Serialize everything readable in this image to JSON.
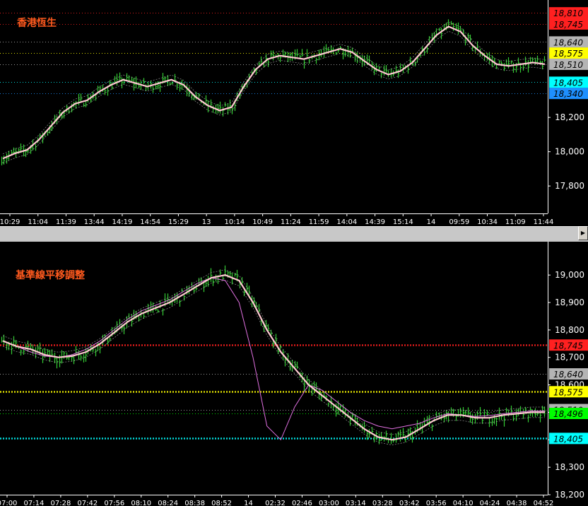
{
  "chart_data": [
    {
      "type": "line",
      "title": "香港恆生",
      "xlabel": "",
      "ylabel": "",
      "ylim": [
        17640,
        18860
      ],
      "y_ticks": [
        "18,200",
        "18,000",
        "17,800"
      ],
      "x_tick_labels": [
        "10:29",
        "11:04",
        "11:39",
        "13:44",
        "14:19",
        "14:54",
        "15:29",
        "13",
        "10:14",
        "10:49",
        "11:24",
        "11:59",
        "14:04",
        "14:39",
        "15:14",
        "14",
        "09:59",
        "10:34",
        "11:09",
        "11:44"
      ],
      "level_badges": [
        {
          "label": "18,810",
          "value": 18810,
          "color": "#ff2020"
        },
        {
          "label": "18,745",
          "value": 18745,
          "color": "#ff2020"
        },
        {
          "label": "18,640",
          "value": 18640,
          "color": "#b4b4b4"
        },
        {
          "label": "18,575",
          "value": 18575,
          "color": "#ffff00"
        },
        {
          "label": "18,510",
          "value": 18510,
          "color": "#b4b4b4"
        },
        {
          "label": "18,405",
          "value": 18405,
          "color": "#00ffff"
        },
        {
          "label": "18,340",
          "value": 18340,
          "color": "#1e90ff"
        }
      ],
      "series": [
        {
          "values": [
            17960,
            17990,
            18010,
            18070,
            18150,
            18230,
            18280,
            18300,
            18350,
            18390,
            18420,
            18400,
            18380,
            18400,
            18420,
            18390,
            18320,
            18270,
            18240,
            18260,
            18380,
            18480,
            18540,
            18560,
            18550,
            18540,
            18560,
            18580,
            18600,
            18580,
            18530,
            18480,
            18450,
            18470,
            18520,
            18600,
            18680,
            18730,
            18700,
            18620,
            18560,
            18510,
            18500,
            18510,
            18520,
            18510
          ]
        }
      ],
      "color": "#ffc8d2"
    },
    {
      "type": "line",
      "title": "基準線平移調整",
      "xlabel": "",
      "ylabel": "",
      "ylim": [
        18200,
        19070
      ],
      "y_ticks": [
        "19,000",
        "18,900",
        "18,800",
        "18,700",
        "18,600",
        "18,500",
        "18,400",
        "18,300",
        "18,200"
      ],
      "x_tick_labels": [
        "07:00",
        "07:14",
        "07:28",
        "07:42",
        "07:56",
        "08:10",
        "08:24",
        "08:38",
        "08:52",
        "14",
        "02:32",
        "02:46",
        "03:00",
        "03:14",
        "03:28",
        "03:42",
        "03:56",
        "04:10",
        "04:24",
        "04:38",
        "04:52"
      ],
      "level_badges": [
        {
          "label": "18,745",
          "value": 18745,
          "color": "#ff2020"
        },
        {
          "label": "18,640",
          "value": 18640,
          "color": "#b4b4b4"
        },
        {
          "label": "18,575",
          "value": 18575,
          "color": "#ffff00"
        },
        {
          "label": "18,510",
          "value": 18510,
          "color": "#b4b4b4"
        },
        {
          "label": "18,496",
          "value": 18496,
          "color": "#00ff00"
        },
        {
          "label": "18,405",
          "value": 18405,
          "color": "#00ffff"
        }
      ],
      "series": [
        {
          "values": [
            18760,
            18740,
            18730,
            18710,
            18700,
            18705,
            18720,
            18750,
            18790,
            18830,
            18860,
            18880,
            18900,
            18930,
            18960,
            18990,
            19000,
            18980,
            18900,
            18800,
            18720,
            18660,
            18600,
            18560,
            18520,
            18480,
            18440,
            18410,
            18400,
            18410,
            18440,
            18470,
            18490,
            18490,
            18480,
            18480,
            18490,
            18495,
            18500,
            18500
          ]
        },
        {
          "values": [
            18760,
            18740,
            18720,
            18705,
            18700,
            18710,
            18730,
            18760,
            18800,
            18840,
            18870,
            18890,
            18910,
            18940,
            18970,
            18990,
            18980,
            18900,
            18700,
            18450,
            18400,
            18520,
            18600,
            18580,
            18540,
            18500,
            18470,
            18450,
            18440,
            18450,
            18460,
            18480,
            18495,
            18490,
            18485,
            18488,
            18495,
            18500,
            18505,
            18505
          ]
        }
      ],
      "color": "#ffc8d2"
    }
  ],
  "colors": {
    "background": "#000000",
    "bars": "#33cc33",
    "smooth_line": "#ffc8d2",
    "lag_line": "#e070e0",
    "title": "#ff5a1e",
    "red_level": "#ff2020",
    "grey_level": "#b4b4b4",
    "yellow_level": "#ffff00",
    "cyan_level": "#00ffff",
    "blue_level": "#1e90ff"
  },
  "window_buttons": {
    "restore": "⧉",
    "minimize": "_",
    "maximize": "□",
    "close": "✕"
  },
  "scroll_arrow": "▶"
}
